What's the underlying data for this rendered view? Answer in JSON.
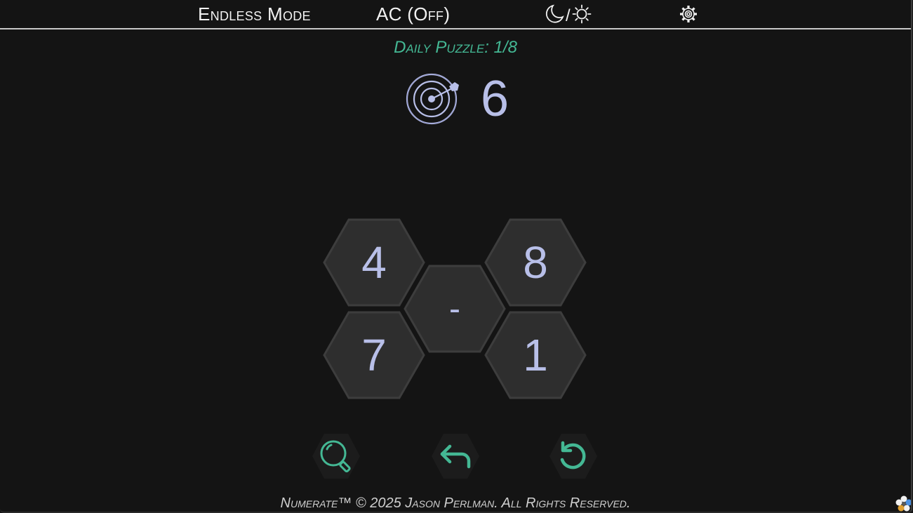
{
  "header": {
    "mode_label": "Endless Mode",
    "ac_label": "AC (Off)",
    "theme_separator": "/",
    "icons": [
      "moon-icon",
      "sun-icon",
      "gear-icon"
    ]
  },
  "puzzle": {
    "daily_label": "Daily Puzzle: 1/8",
    "target_value": "6"
  },
  "board": {
    "tiles": [
      {
        "label": "4",
        "kind": "number"
      },
      {
        "label": "8",
        "kind": "number"
      },
      {
        "label": "-",
        "kind": "operator"
      },
      {
        "label": "7",
        "kind": "number"
      },
      {
        "label": "1",
        "kind": "number"
      }
    ]
  },
  "tools": [
    "hint-magnifier-icon",
    "undo-arrow-icon",
    "reset-icon"
  ],
  "footer": {
    "copyright": "Numerate™ © 2025 Jason Perlman. All Rights Reserved."
  },
  "colors": {
    "background": "#141414",
    "hex_fill": "#2e2e2e",
    "hex_stroke": "#3d3d3d",
    "number": "#b8bfe8",
    "accent": "#44b894",
    "text": "#f2f2f2"
  }
}
